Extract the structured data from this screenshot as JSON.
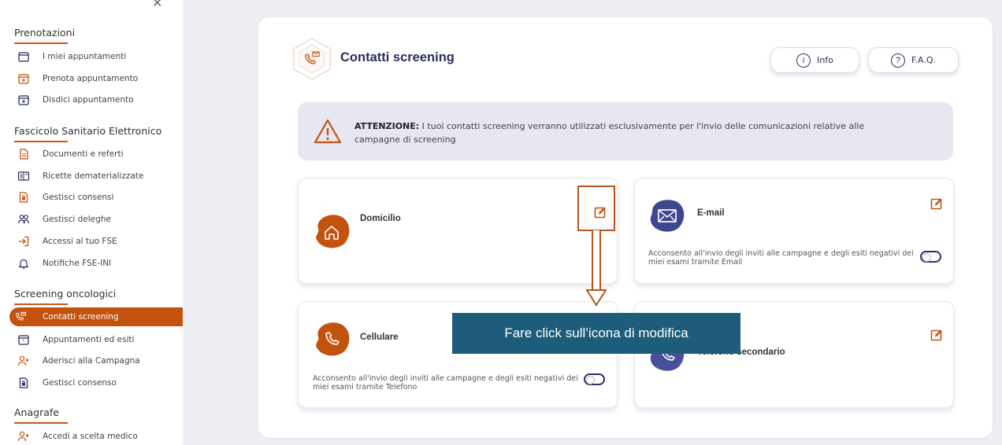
{
  "sidebar": {
    "sections": [
      {
        "title": "Prenotazioni",
        "items": [
          {
            "label": "I miei appuntamenti",
            "icon": "calendar-icon"
          },
          {
            "label": "Prenota appuntamento",
            "icon": "calendar-add-icon"
          },
          {
            "label": "Disdici appuntamento",
            "icon": "calendar-cancel-icon"
          }
        ]
      },
      {
        "title": "Fascicolo Sanitario Elettronico",
        "items": [
          {
            "label": "Documenti e referti",
            "icon": "document-icon"
          },
          {
            "label": "Ricette dematerializzate",
            "icon": "prescription-icon"
          },
          {
            "label": "Gestisci consensi",
            "icon": "lock-document-icon"
          },
          {
            "label": "Gestisci deleghe",
            "icon": "people-icon"
          },
          {
            "label": "Accessi al tuo FSE",
            "icon": "login-icon"
          },
          {
            "label": "Notifiche FSE-INI",
            "icon": "bell-icon"
          }
        ]
      },
      {
        "title": "Screening oncologici",
        "items": [
          {
            "label": "Contatti screening",
            "icon": "phone-mail-icon",
            "active": true
          },
          {
            "label": "Appuntamenti ed esiti",
            "icon": "calendar-icon"
          },
          {
            "label": "Aderisci alla Campagna",
            "icon": "person-add-icon"
          },
          {
            "label": "Gestisci consenso",
            "icon": "lock-document-icon"
          }
        ]
      },
      {
        "title": "Anagrafe",
        "items": [
          {
            "label": "Accedi a scelta medico",
            "icon": "person-add-icon"
          }
        ]
      }
    ]
  },
  "page": {
    "title": "Contatti screening",
    "info_label": "Info",
    "faq_label": "F.A.Q.",
    "alert": {
      "strong": "ATTENZIONE:",
      "text": " I tuoi contatti screening verranno utilizzati esclusivamente per l'invio delle comunicazioni relative alle campagne di screening"
    }
  },
  "cards": {
    "domicilio": {
      "title": "Domicilio"
    },
    "email": {
      "title": "E-mail",
      "consent": "Acconsento all'invio degli inviti alle campagne e degli esiti negativi dei miei esami tramite Email"
    },
    "cellulare": {
      "title": "Cellulare",
      "consent": "Acconsento all'invio degli inviti alle campagne e degli esiti negativi dei miei esami tramite Telefono"
    },
    "telefono": {
      "title": "Telefono secondario"
    }
  },
  "annotation": {
    "callout": "Fare click sull’icona di modifica"
  },
  "colors": {
    "accent": "#c3520f",
    "navy": "#2b2f5a",
    "email_blob": "#3f458e",
    "callout_bg": "#1d5c7a"
  }
}
